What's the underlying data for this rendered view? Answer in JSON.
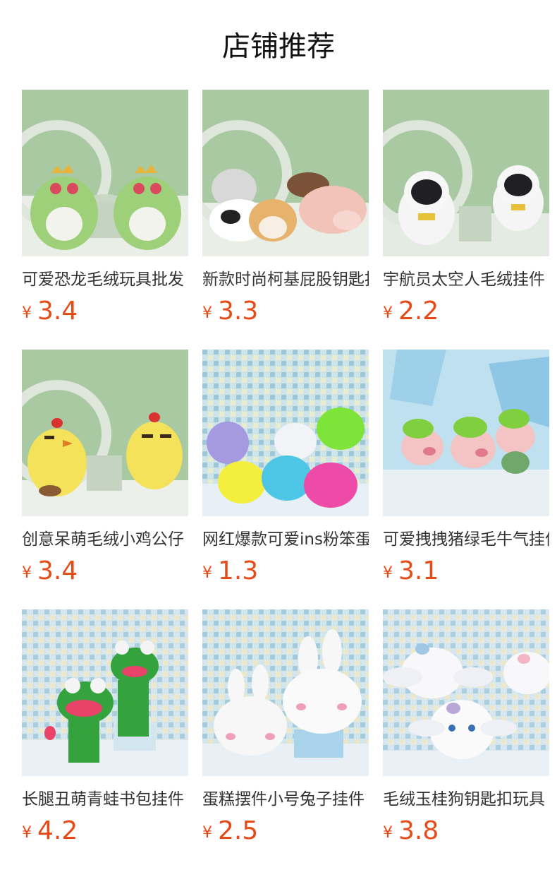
{
  "section": {
    "title": "店铺推荐"
  },
  "currency_symbol": "¥",
  "products": [
    {
      "name": "可爱恐龙毛绒玩具批发",
      "price": "3.4",
      "image_icon": "green-dinosaur-plush"
    },
    {
      "name": "新款时尚柯基屁股钥匙扣",
      "price": "3.3",
      "image_icon": "corgi-butt-plush"
    },
    {
      "name": "宇航员太空人毛绒挂件",
      "price": "2.2",
      "image_icon": "astronaut-plush"
    },
    {
      "name": "创意呆萌毛绒小鸡公仔",
      "price": "3.4",
      "image_icon": "yellow-chick-plush"
    },
    {
      "name": "网红爆款可爱ins粉笨蛋",
      "price": "1.3",
      "image_icon": "furry-monster-plush"
    },
    {
      "name": "可爱拽拽猪绿毛牛气挂件",
      "price": "3.1",
      "image_icon": "green-hair-pig-plush"
    },
    {
      "name": "长腿丑萌青蛙书包挂件",
      "price": "4.2",
      "image_icon": "green-frog-plush"
    },
    {
      "name": "蛋糕摆件小号兔子挂件",
      "price": "2.5",
      "image_icon": "white-bunny-plush"
    },
    {
      "name": "毛绒玉桂狗钥匙扣玩具",
      "price": "3.8",
      "image_icon": "cinnamon-dog-plush"
    }
  ]
}
